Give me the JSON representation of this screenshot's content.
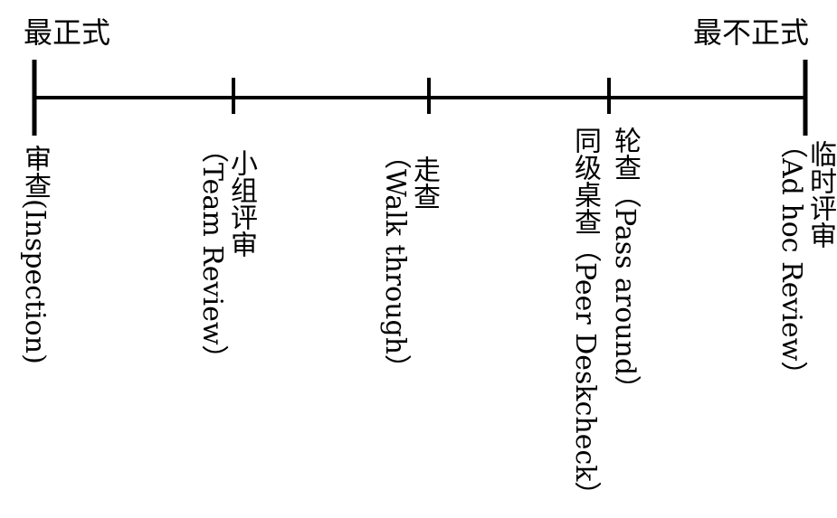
{
  "ends": {
    "left": "最正式",
    "right": "最不正式"
  },
  "items": [
    {
      "id": "inspection",
      "lines": [
        "审查(Inspection)"
      ]
    },
    {
      "id": "team-review",
      "lines": [
        "小组评审",
        "（Team Review）"
      ]
    },
    {
      "id": "walkthrough",
      "lines": [
        "走查",
        "（Walk through）"
      ]
    },
    {
      "id": "pass-around",
      "lines": [
        "轮查（Pass around）"
      ]
    },
    {
      "id": "peer-deskcheck",
      "lines": [
        "同级桌查（Peer Deskcheck）"
      ]
    },
    {
      "id": "ad-hoc",
      "lines": [
        "临时评审",
        "（Ad hoc Review）"
      ]
    }
  ]
}
